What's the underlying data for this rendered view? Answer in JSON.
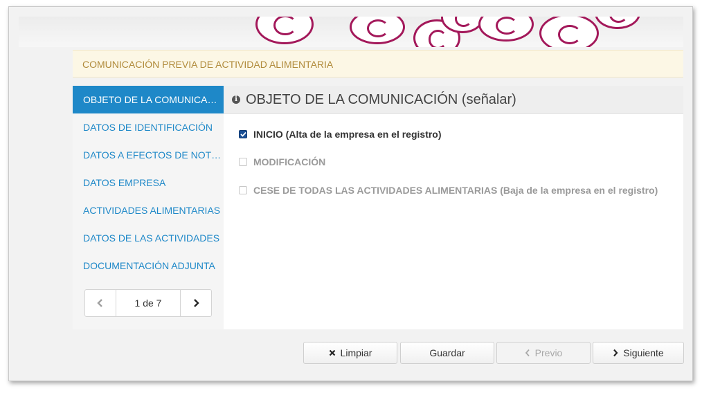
{
  "header": {
    "title": "COMUNICACIÓN PREVIA DE ACTIVIDAD ALIMENTARIA"
  },
  "sidebar": {
    "items": [
      {
        "label": "OBJETO DE LA COMUNICACIÓN",
        "active": true
      },
      {
        "label": "DATOS DE IDENTIFICACIÓN",
        "active": false
      },
      {
        "label": "DATOS A EFECTOS DE NOTIFICACIÓN",
        "active": false
      },
      {
        "label": "DATOS EMPRESA",
        "active": false
      },
      {
        "label": "ACTIVIDADES ALIMENTARIAS",
        "active": false
      },
      {
        "label": "DATOS DE LAS ACTIVIDADES",
        "active": false
      },
      {
        "label": "DOCUMENTACIÓN ADJUNTA",
        "active": false
      }
    ],
    "pager": {
      "text": "1 de 7",
      "prev_icon": "chevron-left-icon",
      "next_icon": "chevron-right-icon"
    }
  },
  "main": {
    "section_title": "OBJETO DE LA COMUNICACIÓN (señalar)",
    "section_icon": "info-circle-icon",
    "options": [
      {
        "label": "INICIO (Alta de la empresa en el registro)",
        "checked": true,
        "enabled": true
      },
      {
        "label": "MODIFICACIÓN",
        "checked": false,
        "enabled": false
      },
      {
        "label": "CESE DE TODAS LAS ACTIVIDADES ALIMENTARIAS (Baja de la empresa en el registro)",
        "checked": false,
        "enabled": false
      }
    ]
  },
  "footer": {
    "buttons": {
      "clear": {
        "label": "Limpiar",
        "icon": "x-icon"
      },
      "save": {
        "label": "Guardar"
      },
      "prev": {
        "label": "Previo",
        "icon": "chevron-left-icon",
        "disabled": true
      },
      "next": {
        "label": "Siguiente",
        "icon": "chevron-right-icon"
      }
    }
  },
  "colors": {
    "accent": "#1e88c8",
    "banner_swirl": "#a3185a",
    "title_text": "#b08a3a",
    "title_bg": "#fcf7e5"
  }
}
